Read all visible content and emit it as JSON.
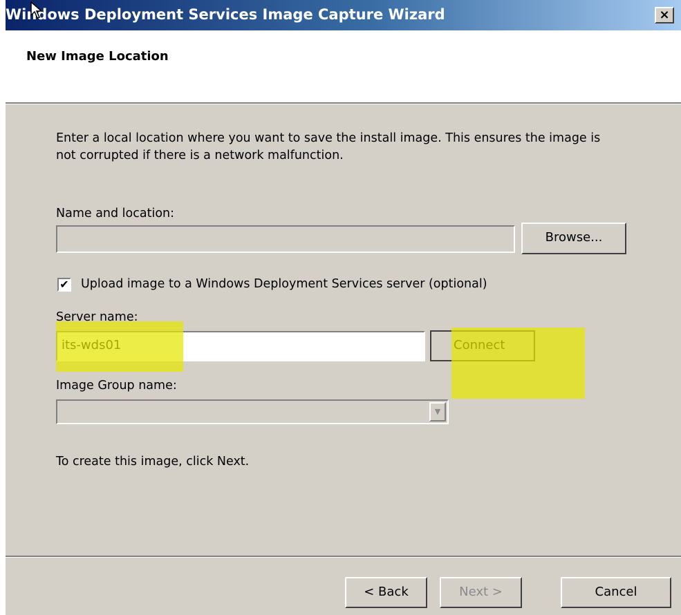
{
  "window": {
    "title": "Windows Deployment Services Image Capture Wizard",
    "close_label": "×"
  },
  "header": {
    "title": "New Image Location"
  },
  "content": {
    "instructions": "Enter a local location where you want to save the install image. This ensures the image is not corrupted if there is a network malfunction.",
    "name_location_label": "Name and location:",
    "name_location_value": "",
    "browse_label": "Browse...",
    "upload_checkbox": {
      "checked": true,
      "check_glyph": "✔",
      "label": "Upload image to a Windows Deployment Services server (optional)"
    },
    "server_name_label": "Server name:",
    "server_name_value": "its-wds01",
    "connect_label": "Connect",
    "image_group_label": "Image Group name:",
    "image_group_value": "",
    "image_group_arrow": "▼",
    "next_hint": "To create this image, click Next."
  },
  "footer": {
    "back_label": "< Back",
    "next_label": "Next >",
    "cancel_label": "Cancel"
  },
  "colors": {
    "dialog_bg": "#d4d0c8",
    "titlebar_start": "#0a246a",
    "highlight": "#e6e600"
  }
}
